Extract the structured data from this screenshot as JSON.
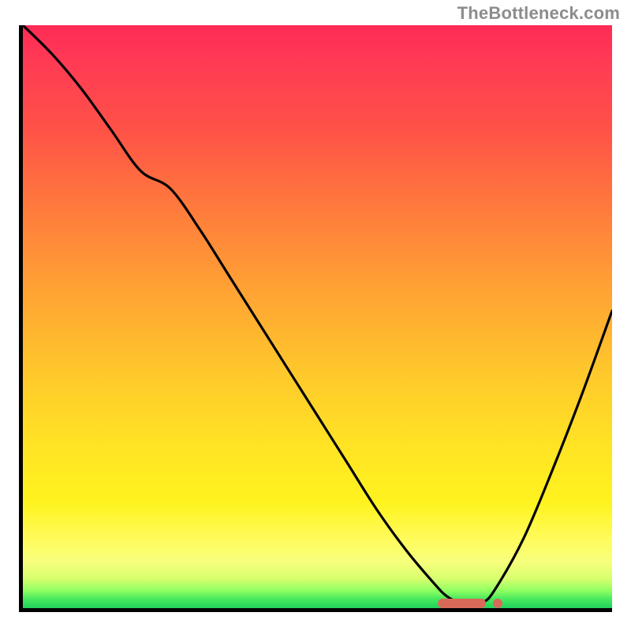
{
  "attribution": "TheBottleneck.com",
  "colors": {
    "curve": "#000000",
    "marker": "#d96a5a",
    "gradient_top": "#ff2a55",
    "gradient_bottom": "#22d15b"
  },
  "chart_data": {
    "type": "line",
    "title": "",
    "xlabel": "",
    "ylabel": "",
    "xlim": [
      0,
      100
    ],
    "ylim": [
      0,
      100
    ],
    "x": [
      0,
      5,
      10,
      15,
      20,
      25,
      30,
      35,
      40,
      45,
      50,
      55,
      60,
      65,
      70,
      72,
      74,
      76,
      78,
      80,
      85,
      90,
      95,
      100
    ],
    "values": [
      100,
      95,
      89,
      82,
      75,
      72,
      65,
      57,
      49,
      41,
      33,
      25,
      17,
      10,
      4,
      2,
      1,
      1,
      1,
      3,
      12,
      24,
      37,
      51
    ],
    "marker": {
      "x_start": 70,
      "x_end": 78,
      "dot_x": 80,
      "y": 1.5
    }
  }
}
